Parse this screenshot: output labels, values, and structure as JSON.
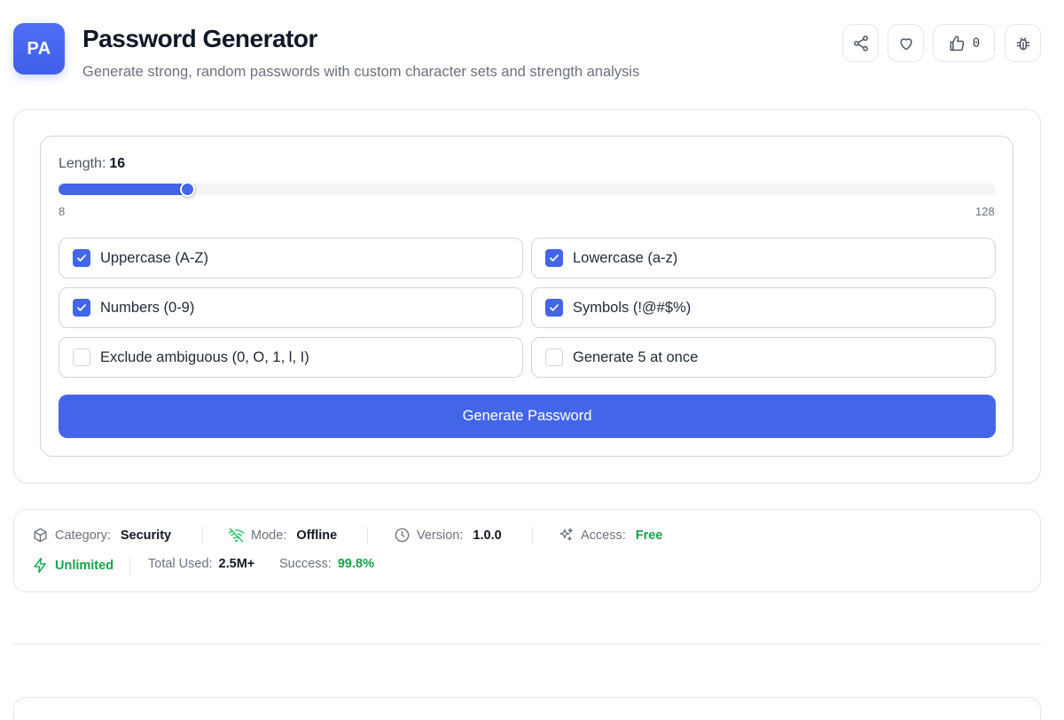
{
  "header": {
    "badge": "PA",
    "title": "Password Generator",
    "subtitle": "Generate strong, random passwords with custom character sets and strength analysis",
    "like_count": "0"
  },
  "length": {
    "label": "Length:",
    "value": "16",
    "min_label": "8",
    "max_label": "128",
    "min": 8,
    "max": 128,
    "current": 16
  },
  "options": [
    {
      "label": "Uppercase (A-Z)",
      "checked": true
    },
    {
      "label": "Lowercase (a-z)",
      "checked": true
    },
    {
      "label": "Numbers (0-9)",
      "checked": true
    },
    {
      "label": "Symbols (!@#$%)",
      "checked": true
    },
    {
      "label": "Exclude ambiguous (0, O, 1, l, I)",
      "checked": false
    },
    {
      "label": "Generate 5 at once",
      "checked": false
    }
  ],
  "generate_button": "Generate Password",
  "info": {
    "category_label": "Category:",
    "category_value": "Security",
    "mode_label": "Mode:",
    "mode_value": "Offline",
    "version_label": "Version:",
    "version_value": "1.0.0",
    "access_label": "Access:",
    "access_value": "Free",
    "unlimited": "Unlimited",
    "total_used_label": "Total Used:",
    "total_used_value": "2.5M+",
    "success_label": "Success:",
    "success_value": "99.8%"
  },
  "colors": {
    "accent": "#4366e8",
    "success": "#16a34a",
    "offline_icon": "#22c55e"
  }
}
